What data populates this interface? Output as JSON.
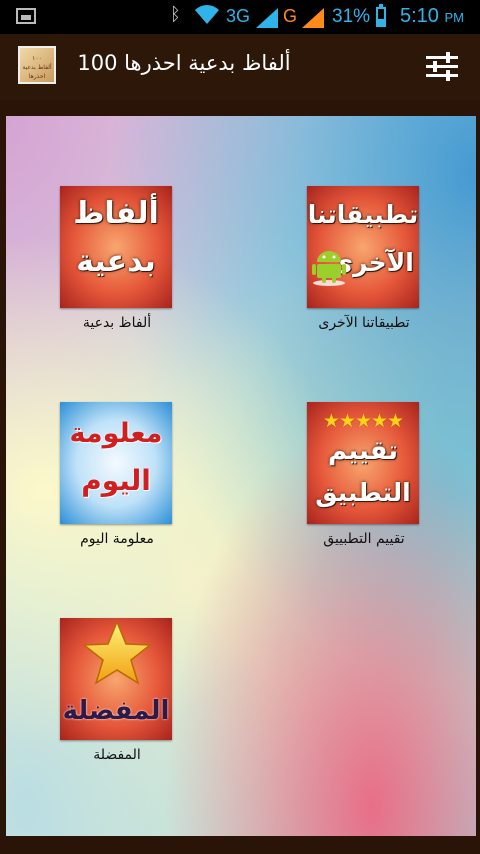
{
  "status_bar": {
    "network_3g": "3G",
    "network_g": "G",
    "battery": "31%",
    "time": "5:10",
    "time_suffix": "PM",
    "colors": {
      "accent": "#2fb4ea",
      "g_indicator": "#ff8a1a"
    }
  },
  "action_bar": {
    "title": "100 ألفاظ بدعية احذرها",
    "app_icon": "app-logo-icon",
    "settings_icon": "sliders-icon"
  },
  "tiles": [
    {
      "id": "other-apps",
      "label": "تطبيقاتنا الآخرى",
      "image_text": [
        "تطبيقاتنا",
        "الآخرى"
      ],
      "icon": "android-icon"
    },
    {
      "id": "bid-words",
      "label": "ألفاظ بدعية",
      "image_text": [
        "ألفاظ",
        "بدعية"
      ]
    },
    {
      "id": "rate-app",
      "label": "تقييم التطبييق",
      "image_text": [
        "تقييم",
        "التطبيق"
      ],
      "icon": "five-stars-icon"
    },
    {
      "id": "daily-info",
      "label": "معلومة اليوم",
      "image_text": [
        "معلومة",
        "اليوم"
      ]
    },
    {
      "id": "favorites",
      "label": "المفضلة",
      "image_text": [
        "المفضلة"
      ],
      "icon": "star-icon"
    }
  ]
}
